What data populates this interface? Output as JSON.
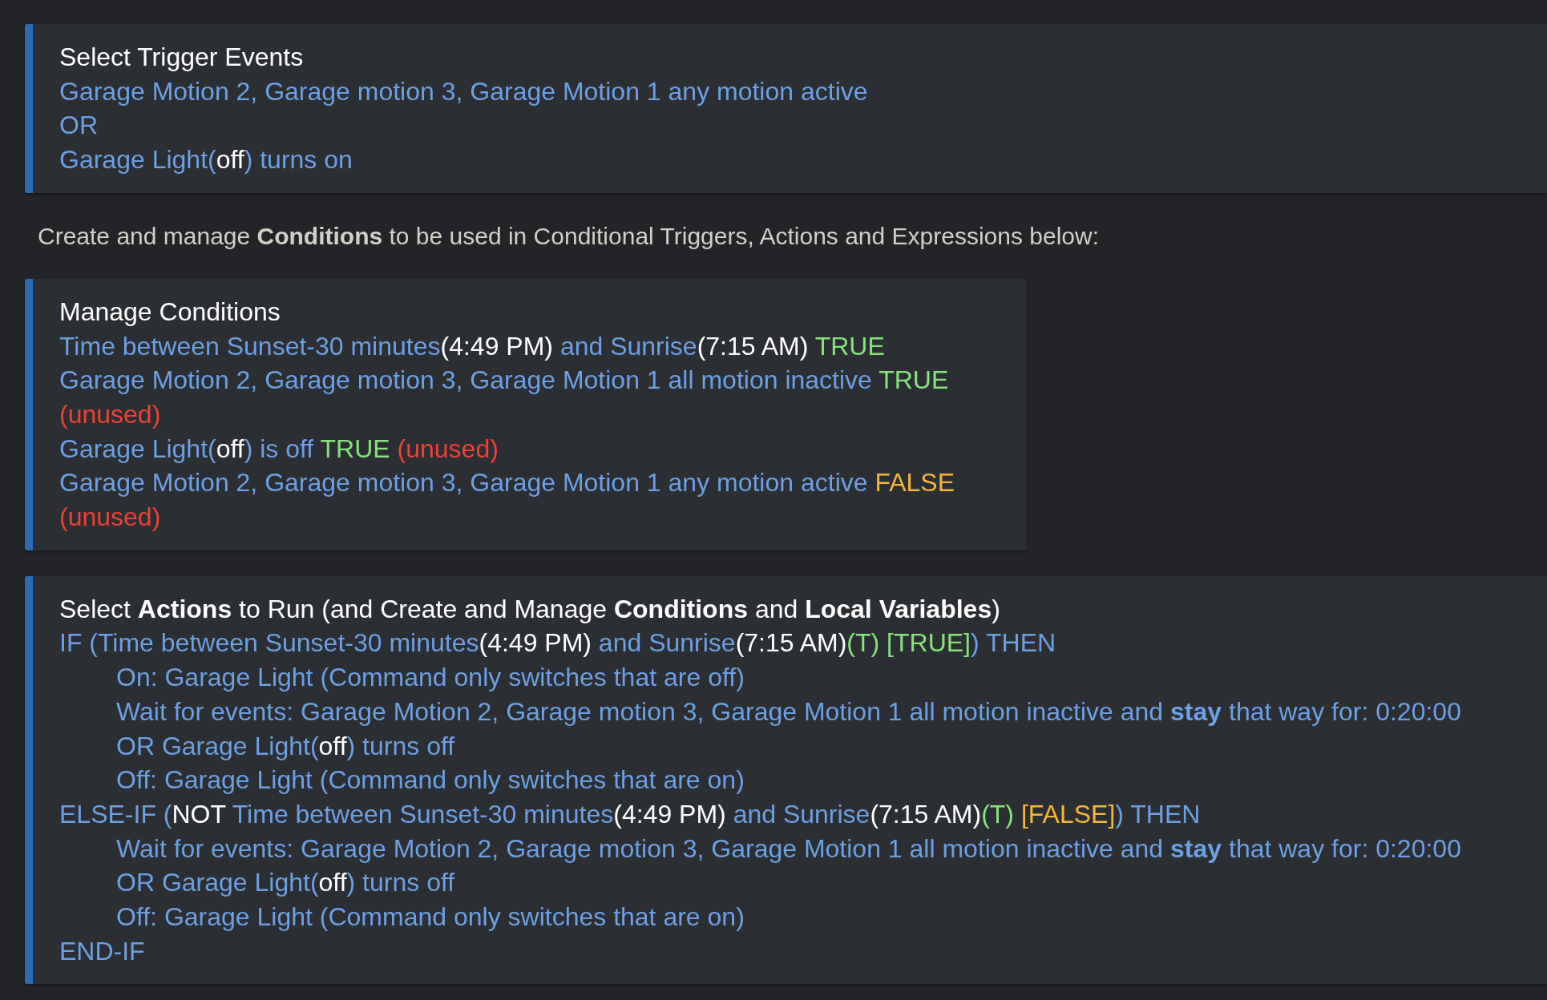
{
  "triggers": {
    "title": "Select Trigger Events",
    "lines": [
      {
        "runs": [
          {
            "kind": "text",
            "text": "Garage Motion 2, Garage motion 3, Garage Motion 1 any motion active"
          }
        ]
      },
      {
        "runs": [
          {
            "kind": "text",
            "text": "OR"
          }
        ]
      },
      {
        "runs": [
          {
            "kind": "text",
            "text": "Garage Light("
          },
          {
            "kind": "value",
            "text": "off"
          },
          {
            "kind": "text",
            "text": ") turns on"
          }
        ]
      }
    ]
  },
  "intro": "Create and manage **Conditions** to be used in Conditional Triggers, Actions and Expressions below:",
  "conditions": {
    "title": "Manage Conditions",
    "lines": [
      {
        "runs": [
          {
            "kind": "text",
            "text": "Time between Sunset-30 minutes"
          },
          {
            "kind": "value",
            "text": "(4:49 PM)"
          },
          {
            "kind": "text",
            "text": " and Sunrise"
          },
          {
            "kind": "value",
            "text": "(7:15 AM)"
          },
          {
            "kind": "true",
            "text": " TRUE"
          }
        ]
      },
      {
        "runs": [
          {
            "kind": "text",
            "text": "Garage Motion 2, Garage motion 3, Garage Motion 1 all motion inactive"
          },
          {
            "kind": "true",
            "text": " TRUE"
          },
          {
            "kind": "unused",
            "text": " (unused)"
          }
        ]
      },
      {
        "runs": [
          {
            "kind": "text",
            "text": "Garage Light("
          },
          {
            "kind": "value",
            "text": "off"
          },
          {
            "kind": "text",
            "text": ") is off"
          },
          {
            "kind": "true",
            "text": " TRUE"
          },
          {
            "kind": "unused",
            "text": " (unused)"
          }
        ]
      },
      {
        "runs": [
          {
            "kind": "text",
            "text": "Garage Motion 2, Garage motion 3, Garage Motion 1 any motion active"
          },
          {
            "kind": "false",
            "text": " FALSE"
          },
          {
            "kind": "unused",
            "text": " (unused)"
          }
        ]
      }
    ]
  },
  "actions": {
    "title": "Select **Actions** to Run (and Create and Manage **Conditions** and **Local Variables**)",
    "lines": [
      {
        "runs": [
          {
            "kind": "text",
            "text": "IF (Time between Sunset-30 minutes"
          },
          {
            "kind": "value",
            "text": "(4:49 PM)"
          },
          {
            "kind": "text",
            "text": " and Sunrise"
          },
          {
            "kind": "value",
            "text": "(7:15 AM)"
          },
          {
            "kind": "true",
            "text": "(T) [TRUE]"
          },
          {
            "kind": "text",
            "text": ") THEN"
          }
        ],
        "children": [
          {
            "runs": [
              {
                "kind": "text",
                "text": "On: Garage Light (Command only switches that are off)"
              }
            ]
          },
          {
            "runs": [
              {
                "kind": "text",
                "text": "Wait for events: Garage Motion 2, Garage motion 3, Garage Motion 1 all motion inactive and **stay** that way for: 0:20:00"
              }
            ]
          },
          {
            "runs": [
              {
                "kind": "text",
                "text": "OR Garage Light("
              },
              {
                "kind": "value",
                "text": "off"
              },
              {
                "kind": "text",
                "text": ") turns off"
              }
            ]
          },
          {
            "runs": [
              {
                "kind": "text",
                "text": "Off: Garage Light (Command only switches that are on)"
              }
            ]
          }
        ]
      },
      {
        "runs": [
          {
            "kind": "text",
            "text": "ELSE-IF ("
          },
          {
            "kind": "value",
            "text": "NOT"
          },
          {
            "kind": "text",
            "text": " Time between Sunset-30 minutes"
          },
          {
            "kind": "value",
            "text": "(4:49 PM)"
          },
          {
            "kind": "text",
            "text": " and Sunrise"
          },
          {
            "kind": "value",
            "text": "(7:15 AM)"
          },
          {
            "kind": "true",
            "text": "(T)"
          },
          {
            "kind": "false",
            "text": " [FALSE]"
          },
          {
            "kind": "text",
            "text": ") THEN"
          }
        ],
        "children": [
          {
            "runs": [
              {
                "kind": "text",
                "text": "Wait for events: Garage Motion 2, Garage motion 3, Garage Motion 1 all motion inactive and **stay** that way for: 0:20:00"
              }
            ]
          },
          {
            "runs": [
              {
                "kind": "text",
                "text": "OR Garage Light("
              },
              {
                "kind": "value",
                "text": "off"
              },
              {
                "kind": "text",
                "text": ") turns off"
              }
            ]
          },
          {
            "runs": [
              {
                "kind": "text",
                "text": "Off: Garage Light (Command only switches that are on)"
              }
            ]
          }
        ]
      },
      {
        "runs": [
          {
            "kind": "text",
            "text": "END-IF"
          }
        ]
      }
    ]
  }
}
